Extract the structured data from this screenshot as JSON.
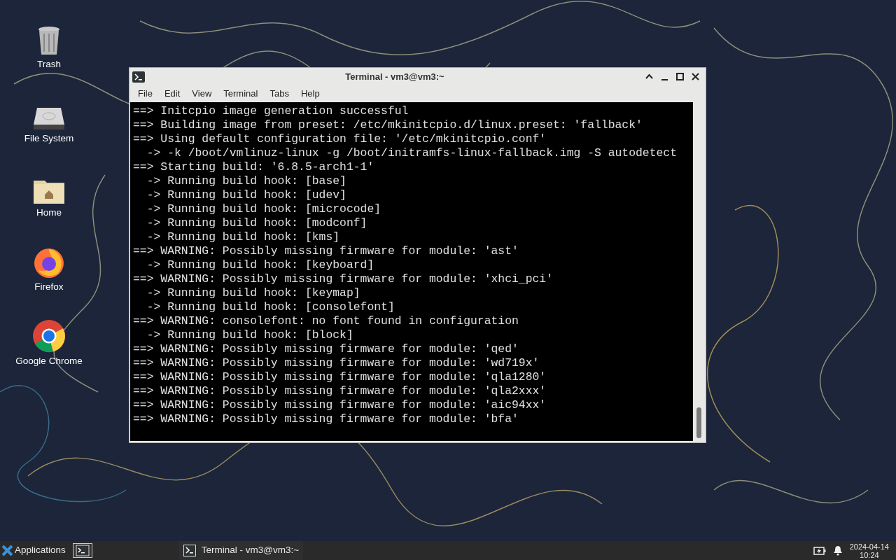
{
  "desktop_icons": [
    {
      "kind": "trash",
      "label": "Trash"
    },
    {
      "kind": "drive",
      "label": "File System"
    },
    {
      "kind": "home",
      "label": "Home"
    },
    {
      "kind": "firefox",
      "label": "Firefox"
    },
    {
      "kind": "chrome",
      "label": "Google Chrome"
    }
  ],
  "window": {
    "title": "Terminal - vm3@vm3:~",
    "menu": [
      "File",
      "Edit",
      "View",
      "Terminal",
      "Tabs",
      "Help"
    ],
    "lines": [
      "==> Initcpio image generation successful",
      "==> Building image from preset: /etc/mkinitcpio.d/linux.preset: 'fallback'",
      "==> Using default configuration file: '/etc/mkinitcpio.conf'",
      "  -> -k /boot/vmlinuz-linux -g /boot/initramfs-linux-fallback.img -S autodetect",
      "==> Starting build: '6.8.5-arch1-1'",
      "  -> Running build hook: [base]",
      "  -> Running build hook: [udev]",
      "  -> Running build hook: [microcode]",
      "  -> Running build hook: [modconf]",
      "  -> Running build hook: [kms]",
      "==> WARNING: Possibly missing firmware for module: 'ast'",
      "  -> Running build hook: [keyboard]",
      "==> WARNING: Possibly missing firmware for module: 'xhci_pci'",
      "  -> Running build hook: [keymap]",
      "  -> Running build hook: [consolefont]",
      "==> WARNING: consolefont: no font found in configuration",
      "  -> Running build hook: [block]",
      "==> WARNING: Possibly missing firmware for module: 'qed'",
      "==> WARNING: Possibly missing firmware for module: 'wd719x'",
      "==> WARNING: Possibly missing firmware for module: 'qla1280'",
      "==> WARNING: Possibly missing firmware for module: 'qla2xxx'",
      "==> WARNING: Possibly missing firmware for module: 'aic94xx'",
      "==> WARNING: Possibly missing firmware for module: 'bfa'"
    ]
  },
  "taskbar": {
    "applications": "Applications",
    "task": "Terminal - vm3@vm3:~",
    "date": "2024-04-14",
    "time": "10:24"
  }
}
